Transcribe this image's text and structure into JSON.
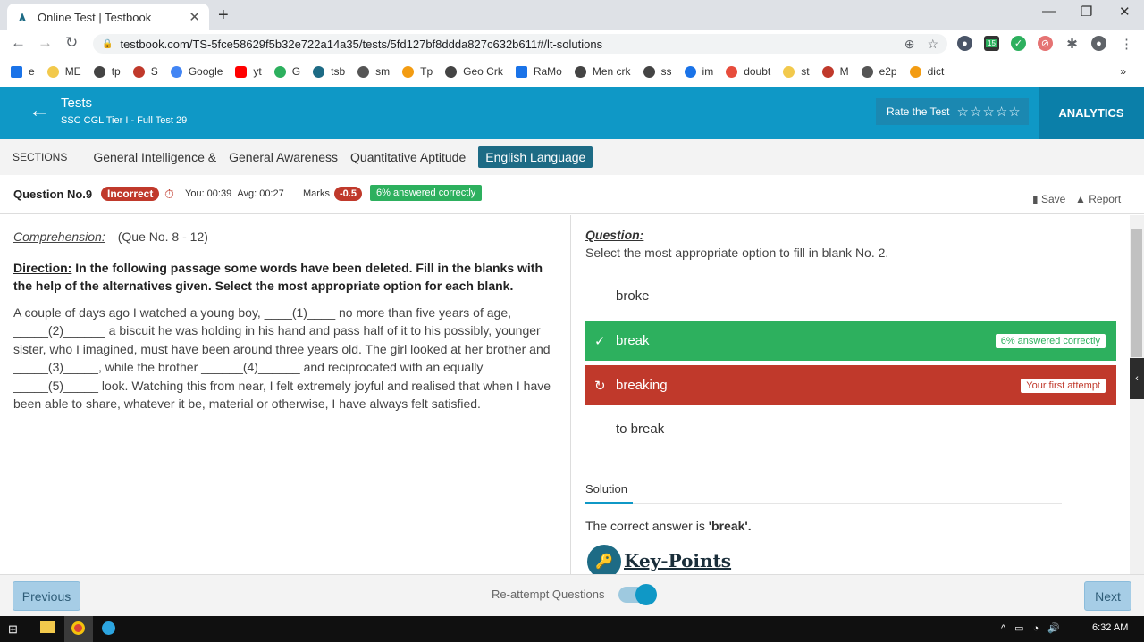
{
  "browser": {
    "tab_title": "Online Test | Testbook",
    "url": "testbook.com/TS-5fce58629f5b32e722a14a35/tests/5fd127bf8ddda827c632b611#/lt-solutions",
    "ext_badge": "15"
  },
  "bookmarks": [
    "e",
    "ME",
    "tp",
    "S",
    "Google",
    "yt",
    "G",
    "tsb",
    "sm",
    "Tp",
    "Geo Crk",
    "RaMo",
    "Men crk",
    "ss",
    "im",
    "doubt",
    "st",
    "M",
    "e2p",
    "dict"
  ],
  "header": {
    "title": "Tests",
    "subtitle": "SSC CGL Tier I - Full Test 29",
    "rate_label": "Rate the Test",
    "stars": "☆☆☆☆☆",
    "analytics": "ANALYTICS"
  },
  "sections": {
    "label": "SECTIONS",
    "items": [
      "General Intelligence &",
      "General Awareness",
      "Quantitative Aptitude",
      "English Language"
    ]
  },
  "question_bar": {
    "number": "Question No.9",
    "status": "Incorrect",
    "you_time": "You: 00:39",
    "avg_time": "Avg: 00:27",
    "marks_label": "Marks",
    "marks": "-0.5",
    "answered_pct": "6% answered correctly",
    "save": "Save",
    "report": "Report"
  },
  "passage": {
    "comprehension_label": "Comprehension:",
    "range": "(Que No. 8 - 12)",
    "direction_label": "Direction:",
    "direction": " In the following passage some words have been deleted. Fill in the blanks with the help of the alternatives given. Select the most appropriate option for each blank.",
    "text": "A couple of days ago I watched a young boy, ____(1)____ no more than five years of age, _____(2)______ a biscuit he was holding in his hand and pass half of it to his possibly, younger sister, who I imagined, must have been around three years old. The girl looked at her brother and _____(3)_____, while the brother ______(4)______ and reciprocated with an equally _____(5)_____ look. Watching this from near, I felt extremely joyful and realised that when I have been able to share, whatever it be, material or otherwise, I have always felt satisfied."
  },
  "question": {
    "label": "Question:",
    "text": "Select the most appropriate option to fill in blank No. 2.",
    "options": [
      "broke",
      "break",
      "breaking",
      "to break"
    ],
    "correct_tag": "6% answered correctly",
    "attempt_tag": "Your first attempt"
  },
  "solution": {
    "tab": "Solution",
    "answer_prefix": "The correct answer is ",
    "answer_value": "'break'.",
    "key_points": "Key-Points"
  },
  "footer": {
    "previous": "Previous",
    "reattempt": "Re-attempt Questions",
    "next": "Next"
  },
  "taskbar": {
    "time": "6:32 AM"
  },
  "colors": {
    "header": "#0f98c6",
    "correct": "#2db05e",
    "wrong": "#c0392b",
    "active_section": "#1d6b85"
  }
}
